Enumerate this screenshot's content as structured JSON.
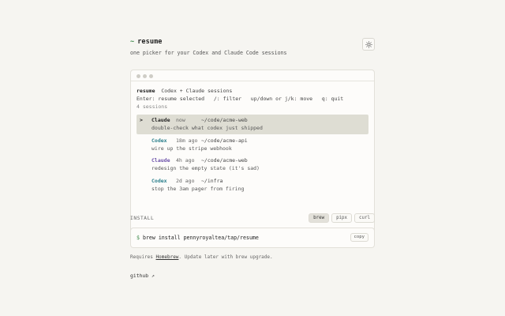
{
  "header": {
    "prompt_symbol": "~",
    "title": "resume",
    "subtitle": "one picker for your Codex and Claude Code sessions",
    "theme_icon": "sun-icon"
  },
  "terminal": {
    "app_name": "resume",
    "app_desc": "Codex + Claude sessions",
    "help_line": "Enter: resume selected   /: filter   up/down or j/k: move   q: quit",
    "count": "4 sessions",
    "selected_marker": ">",
    "sessions": [
      {
        "agent": "Claude",
        "age": "now",
        "path": "~/code/acme-web",
        "message": "double-check what codex just shipped",
        "selected": true
      },
      {
        "agent": "Codex",
        "age": "18m ago",
        "path": "~/code/acme-api",
        "message": "wire up the stripe webhook",
        "selected": false
      },
      {
        "agent": "Claude",
        "age": "4h ago",
        "path": "~/code/acme-web",
        "message": "redesign the empty state (it's sad)",
        "selected": false
      },
      {
        "agent": "Codex",
        "age": "2d ago",
        "path": "~/infra",
        "message": "stop the 3am pager from firing",
        "selected": false
      }
    ]
  },
  "install": {
    "label": "INSTALL",
    "tabs": [
      "brew",
      "pipx",
      "curl"
    ],
    "active_tab": "brew",
    "prompt": "$",
    "command": "brew install pennyroyaltea/tap/resume",
    "copy_label": "copy",
    "note_prefix": "Requires ",
    "note_link": "Homebrew",
    "note_suffix": ". Update later with brew upgrade."
  },
  "footer": {
    "github_label": "github ↗"
  },
  "colors": {
    "background": "#f6f5f1",
    "accent_green": "#3f8a4b",
    "codex": "#2b7f8c",
    "claude": "#6a4fa8",
    "selected_row": "#deddd3"
  }
}
